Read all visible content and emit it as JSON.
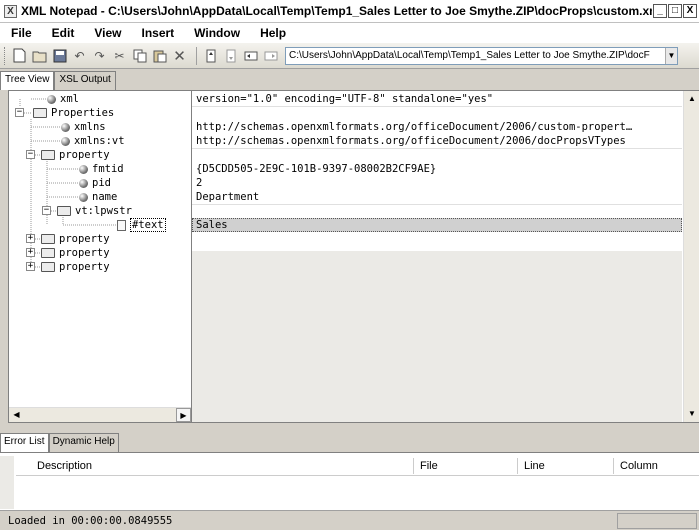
{
  "window": {
    "title": "XML Notepad - C:\\Users\\John\\AppData\\Local\\Temp\\Temp1_Sales Letter to Joe Smythe.ZIP\\docProps\\custom.xml",
    "app_icon": "X",
    "minimize": "_",
    "maximize": "□",
    "close": "X"
  },
  "menu": [
    "File",
    "Edit",
    "View",
    "Insert",
    "Window",
    "Help"
  ],
  "toolbar": {
    "icons": [
      "new-icon",
      "open-icon",
      "save-icon",
      "undo-icon",
      "redo-icon",
      "cut-icon",
      "copy-icon",
      "paste-icon",
      "delete-icon",
      "nudge-up-icon",
      "nudge-down-icon",
      "nudge-left-icon",
      "nudge-right-icon"
    ],
    "path": "C:\\Users\\John\\AppData\\Local\\Temp\\Temp1_Sales Letter to Joe Smythe.ZIP\\docF"
  },
  "tabs": [
    "Tree View",
    "XSL Output"
  ],
  "tree": [
    {
      "label": "xml",
      "icon": "leaf"
    },
    {
      "label": "Properties",
      "icon": "folder"
    },
    {
      "label": "xmlns",
      "icon": "leaf"
    },
    {
      "label": "xmlns:vt",
      "icon": "leaf"
    },
    {
      "label": "property",
      "icon": "folder"
    },
    {
      "label": "fmtid",
      "icon": "leaf"
    },
    {
      "label": "pid",
      "icon": "leaf"
    },
    {
      "label": "name",
      "icon": "leaf"
    },
    {
      "label": "vt:lpwstr",
      "icon": "folder"
    },
    {
      "label": "#text",
      "icon": "text"
    },
    {
      "label": "property",
      "icon": "folder"
    },
    {
      "label": "property",
      "icon": "folder"
    },
    {
      "label": "property",
      "icon": "folder"
    }
  ],
  "values": [
    "version=\"1.0\" encoding=\"UTF-8\" standalone=\"yes\"",
    "",
    "http://schemas.openxmlformats.org/officeDocument/2006/custom-propert…",
    "http://schemas.openxmlformats.org/officeDocument/2006/docPropsVTypes",
    "",
    "{D5CDD505-2E9C-101B-9397-08002B2CF9AE}",
    "2",
    "Department",
    "",
    "Sales"
  ],
  "bottom_tabs": [
    "Error List",
    "Dynamic Help"
  ],
  "error_columns": [
    "Description",
    "File",
    "Line",
    "Column"
  ],
  "status": "Loaded in 00:00:00.0849555"
}
